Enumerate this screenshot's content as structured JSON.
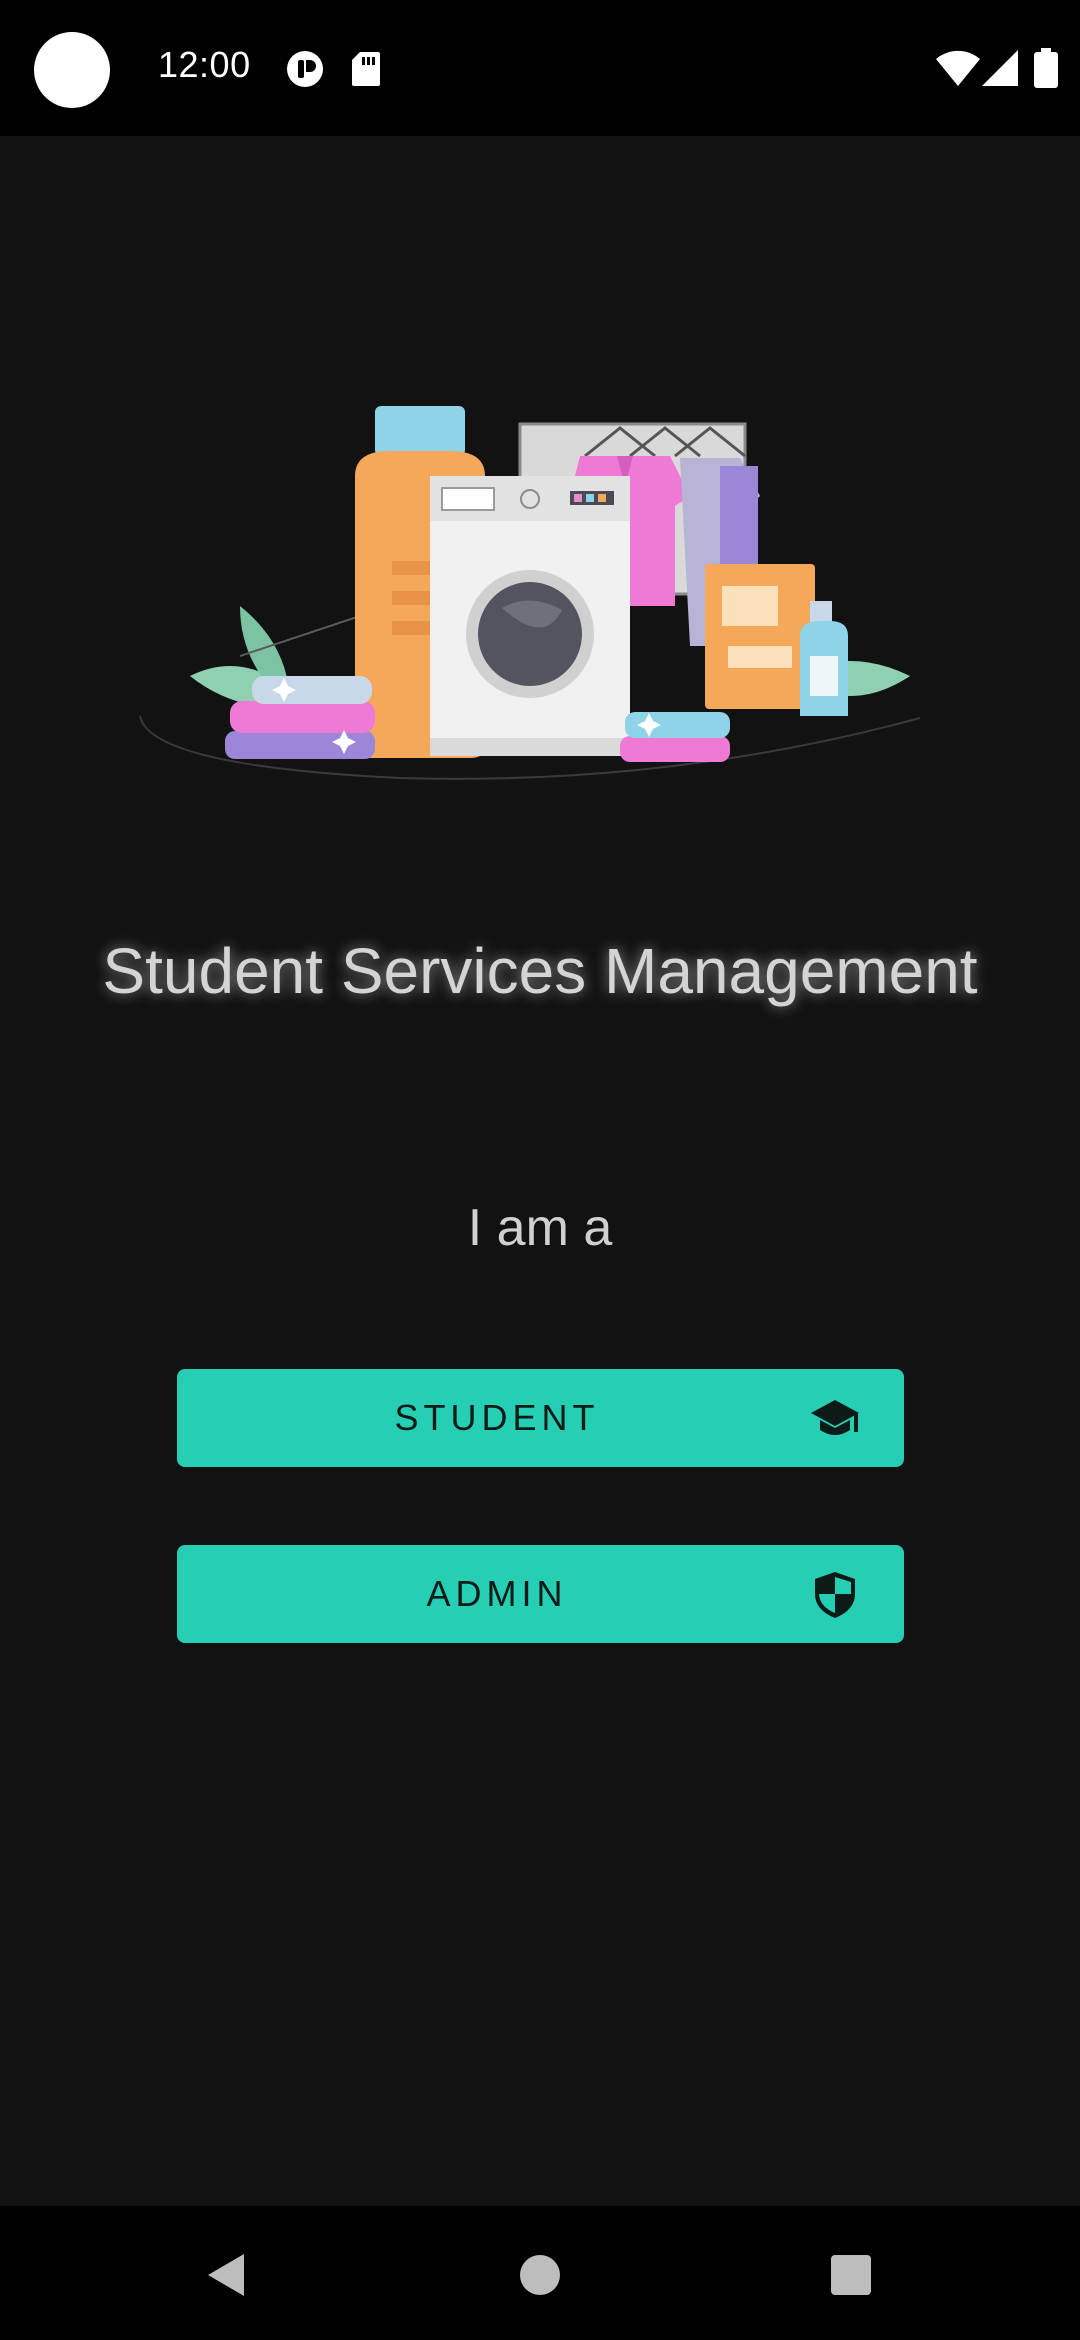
{
  "status_bar": {
    "time": "12:00",
    "icons": [
      "circle-badge-icon",
      "sd-card-icon",
      "wifi-icon",
      "signal-icon",
      "battery-icon"
    ]
  },
  "hero": {
    "image": "laundry-illustration"
  },
  "main": {
    "title": "Student Services Management",
    "prompt": "I am a",
    "buttons": [
      {
        "label": "STUDENT",
        "icon": "graduation-cap-icon"
      },
      {
        "label": "ADMIN",
        "icon": "shield-icon"
      }
    ]
  },
  "nav_bar": {
    "items": [
      "back-icon",
      "home-icon",
      "recents-icon"
    ]
  },
  "colors": {
    "background": "#121212",
    "accent": "#26cfb3",
    "title_text": "#d4d4d4"
  }
}
